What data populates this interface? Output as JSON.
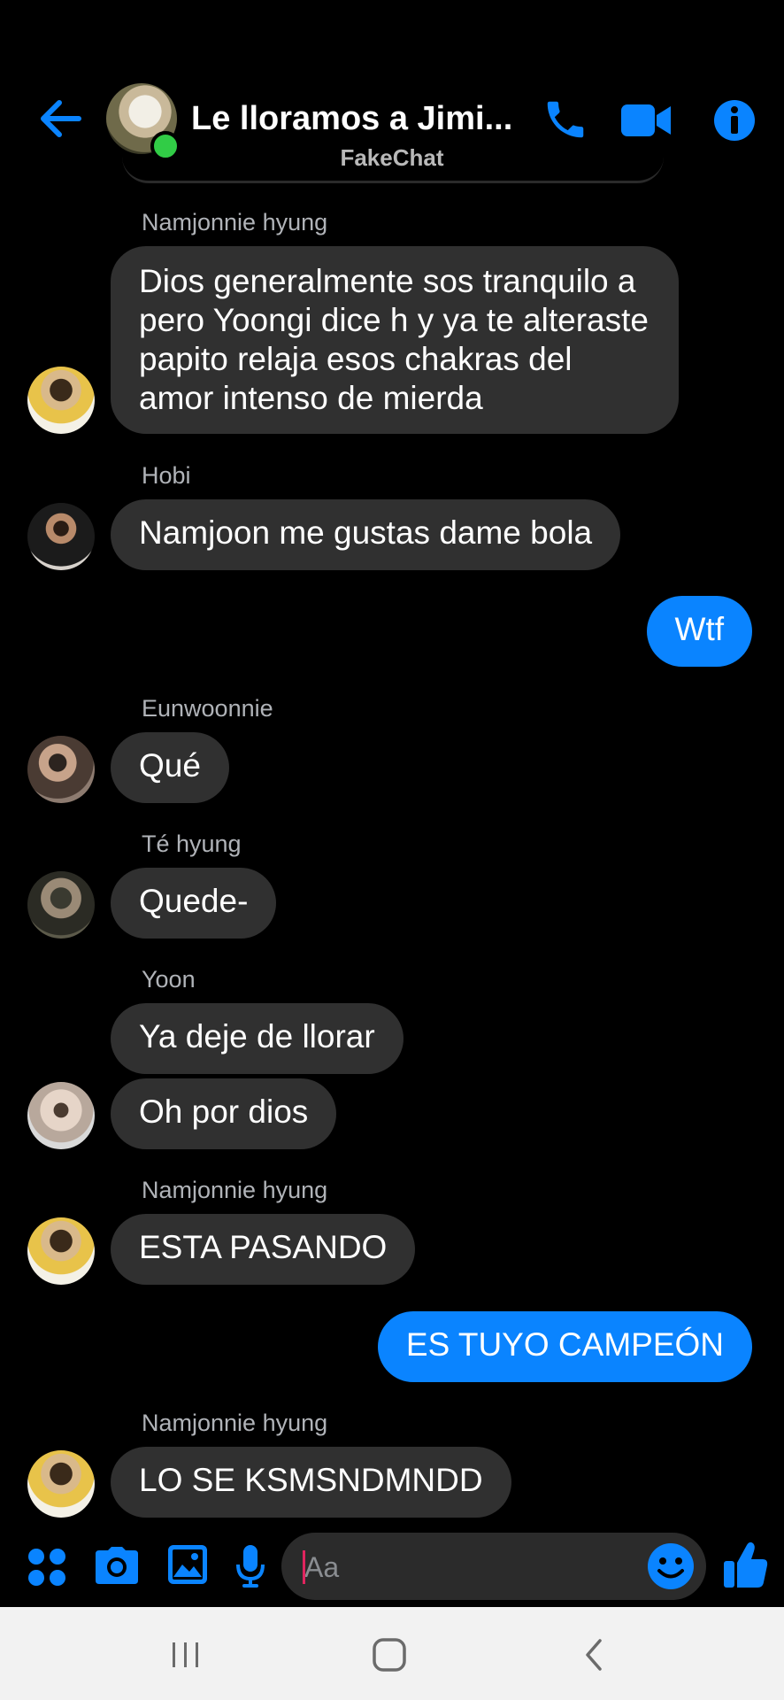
{
  "header": {
    "title": "Le lloramos a Jimi...",
    "watermark": "FakeChat",
    "icons": [
      "back-arrow-icon",
      "phone-icon",
      "video-camera-icon",
      "info-icon"
    ],
    "accent_color": "#0a84ff",
    "online_color": "#31cc46"
  },
  "messages": [
    {
      "sender": "Namjonnie hyung",
      "text": "Dios generalmente sos tranquilo a pero Yoongi dice h y ya te alteraste papito relaja esos chakras del amor intenso de mierda"
    },
    {
      "sender": "Hobi",
      "text": "Namjoon me gustas dame bola"
    },
    {
      "sender": "",
      "text": "Wtf",
      "mine": true
    },
    {
      "sender": "Eunwoonnie",
      "text": "Qué"
    },
    {
      "sender": "Té hyung",
      "text": "Quede-"
    },
    {
      "sender": "Yoon",
      "text": "Ya deje de llorar"
    },
    {
      "sender": "",
      "text": "Oh por dios"
    },
    {
      "sender": "Namjonnie hyung",
      "text": "ESTA PASANDO"
    },
    {
      "sender": "",
      "text": "ES TUYO CAMPEÓN",
      "mine": true
    },
    {
      "sender": "Namjonnie hyung",
      "text": "LO SE KSMSNDMNDD"
    }
  ],
  "composer": {
    "placeholder": "Aa",
    "icons": [
      "apps-grid-icon",
      "camera-icon",
      "gallery-icon",
      "microphone-icon",
      "emoji-icon",
      "thumbs-up-icon"
    ]
  },
  "system_nav": {
    "icons": [
      "recent-apps-icon",
      "home-icon",
      "back-icon"
    ]
  }
}
